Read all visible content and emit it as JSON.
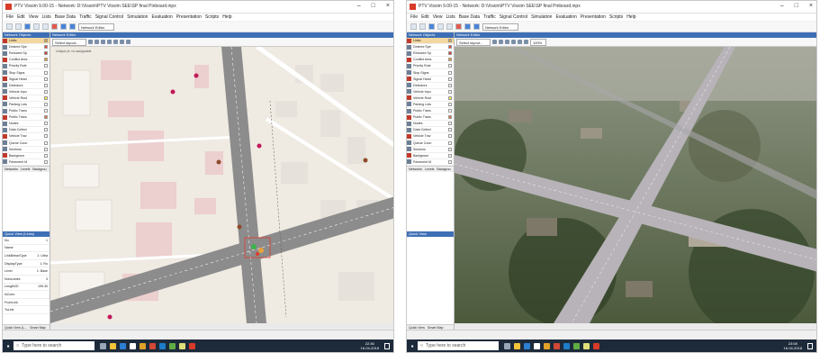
{
  "left": {
    "title": "PTV Vissim 9.00-15 - Network: D:\\Vissim\\PTV Vissim SEE\\SP final Pinboard.inpx",
    "menu": [
      "File",
      "Edit",
      "View",
      "Lists",
      "Base Data",
      "Traffic",
      "Signal Control",
      "Simulation",
      "Evaluation",
      "Presentation",
      "Scripts",
      "Help"
    ],
    "toolbar_select": "Network Editor",
    "panel_header": "Network Objects",
    "objects": [
      {
        "label": "Links",
        "color": "#d9a441"
      },
      {
        "label": "Desired Spe",
        "color": "#e64a3b"
      },
      {
        "label": "Reduced Sp",
        "color": "#d93a2a"
      },
      {
        "label": "Conflict Area",
        "color": "#e9a23b"
      },
      {
        "label": "Priority Rule",
        "color": "#ffffff"
      },
      {
        "label": "Stop Signs",
        "color": "#ffffff"
      },
      {
        "label": "Signal Head",
        "color": "#ffffff"
      },
      {
        "label": "Detectors",
        "color": "#ffffff"
      },
      {
        "label": "Vehicle Inpu",
        "color": "#ffffff"
      },
      {
        "label": "Vehicle Rout",
        "color": "#ffe35c"
      },
      {
        "label": "Parking Lots",
        "color": "#ffffff"
      },
      {
        "label": "Public Trans",
        "color": "#ffffff"
      },
      {
        "label": "Public Trans",
        "color": "#e0773b"
      },
      {
        "label": "Nodes",
        "color": "#ffffff"
      },
      {
        "label": "Data Collect",
        "color": "#ffffff"
      },
      {
        "label": "Vehicle Trav",
        "color": "#ffffff"
      },
      {
        "label": "Queue Coun",
        "color": "#ffffff"
      },
      {
        "label": "Sections",
        "color": "#ffffff"
      },
      {
        "label": "Backgroun",
        "color": "#ffffff"
      },
      {
        "label": "Pavement M",
        "color": "#ffffff"
      }
    ],
    "panel_tabs": [
      "Networks",
      "Levels",
      "Backgrou"
    ],
    "qv_header": "Quick View (Links)",
    "qv_rows": [
      {
        "k": "Nu",
        "v": "1"
      },
      {
        "k": "Name",
        "v": ""
      },
      {
        "k": "LinkBehavType",
        "v": "1: Urba"
      },
      {
        "k": "DisplayType",
        "v": "1: Ro"
      },
      {
        "k": "Level",
        "v": "1: Base"
      },
      {
        "k": "NumLanes",
        "v": "3"
      },
      {
        "k": "Length2D",
        "v": "195.30"
      },
      {
        "k": "IsConn",
        "v": ""
      },
      {
        "k": "FromLink",
        "v": ""
      },
      {
        "k": "ToLink",
        "v": ""
      }
    ],
    "qv_tabs": [
      "Quick View (L...",
      "Smart Map"
    ],
    "editor_header": "Network Editor",
    "editor_select": "Select layout...",
    "canvas_note": "Unique pt: no assignable",
    "search_placeholder": "Type here to search",
    "clock_time": "22:36",
    "clock_date": "16-04-2018"
  },
  "right": {
    "title": "PTV Vissim 9.00-15 - Network: D:\\Vissim\\PTV Vissim SEE\\SP final Pinboard.inpx",
    "menu": [
      "File",
      "Edit",
      "View",
      "Lists",
      "Base Data",
      "Traffic",
      "Signal Control",
      "Simulation",
      "Evaluation",
      "Presentation",
      "Scripts",
      "Help"
    ],
    "toolbar_select": "Network Editor",
    "panel_header": "Network Objects",
    "objects": [
      {
        "label": "Links",
        "color": "#d9a441"
      },
      {
        "label": "Desired Spe",
        "color": "#e64a3b"
      },
      {
        "label": "Reduced Sp",
        "color": "#d93a2a"
      },
      {
        "label": "Conflict Area",
        "color": "#e9a23b"
      },
      {
        "label": "Priority Rule",
        "color": "#ffffff"
      },
      {
        "label": "Stop Signs",
        "color": "#ffffff"
      },
      {
        "label": "Signal Head",
        "color": "#ffffff"
      },
      {
        "label": "Detectors",
        "color": "#ffffff"
      },
      {
        "label": "Vehicle Inpu",
        "color": "#ffffff"
      },
      {
        "label": "Vehicle Rout",
        "color": "#ffe35c"
      },
      {
        "label": "Parking Lots",
        "color": "#ffffff"
      },
      {
        "label": "Public Trans",
        "color": "#ffffff"
      },
      {
        "label": "Public Trans",
        "color": "#e0773b"
      },
      {
        "label": "Nodes",
        "color": "#ffffff"
      },
      {
        "label": "Data Collect",
        "color": "#ffffff"
      },
      {
        "label": "Vehicle Trav",
        "color": "#ffffff"
      },
      {
        "label": "Queue Coun",
        "color": "#ffffff"
      },
      {
        "label": "Sections",
        "color": "#ffffff"
      },
      {
        "label": "Backgroun",
        "color": "#ffffff"
      },
      {
        "label": "Pavement M",
        "color": "#ffffff"
      }
    ],
    "panel_tabs": [
      "Networks",
      "Levels",
      "Backgrou"
    ],
    "qv_header": "Quick View",
    "qv_tabs": [
      "Quick View",
      "Smart Map"
    ],
    "editor_header": "Network Editor",
    "editor_select": "Select layout...",
    "zoom": "100%",
    "search_placeholder": "Type here to search",
    "clock_time": "23:08",
    "clock_date": "16-04-2018"
  },
  "colors": {
    "accent": "#3e6fb5",
    "taskbar": "#1d2a3a",
    "road": "#8c8c8c",
    "map_bg": "#efeae2",
    "building": "#eccfcf",
    "satellite_dark": "#3a4a2e"
  }
}
